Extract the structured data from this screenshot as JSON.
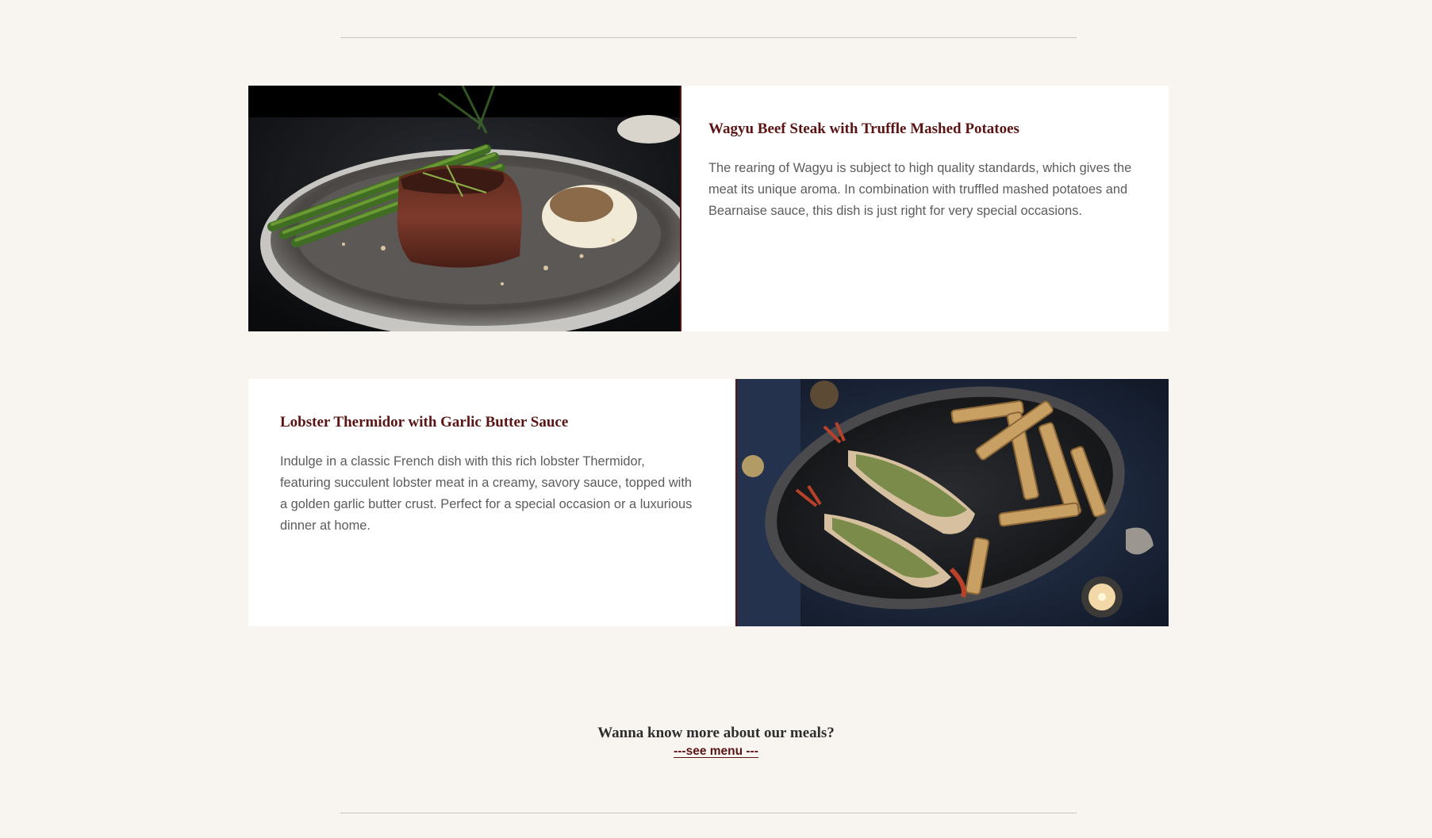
{
  "dishes": [
    {
      "title": "Wagyu Beef Steak with Truffle Mashed Potatoes",
      "description": "The rearing of Wagyu is subject to high quality standards, which gives the meat its unique aroma. In combination with truffled mashed potatoes and Bearnaise sauce, this dish is just right for very special occasions.",
      "image": "steak-dish-photo"
    },
    {
      "title": "Lobster Thermidor with Garlic Butter Sauce",
      "description": "Indulge in a classic French dish with this rich lobster Thermidor, featuring succulent lobster meat in a creamy, savory sauce, topped with a golden garlic butter crust. Perfect for a special occasion or a luxurious dinner at home.",
      "image": "lobster-dish-photo"
    }
  ],
  "cta": {
    "question": "Wanna know more about our meals?",
    "link_label": "---see menu ---"
  },
  "colors": {
    "background": "#f8f5f1",
    "accent": "#5a1414",
    "body_text": "#5c5c5c",
    "heading_text": "#2e2e2e"
  }
}
